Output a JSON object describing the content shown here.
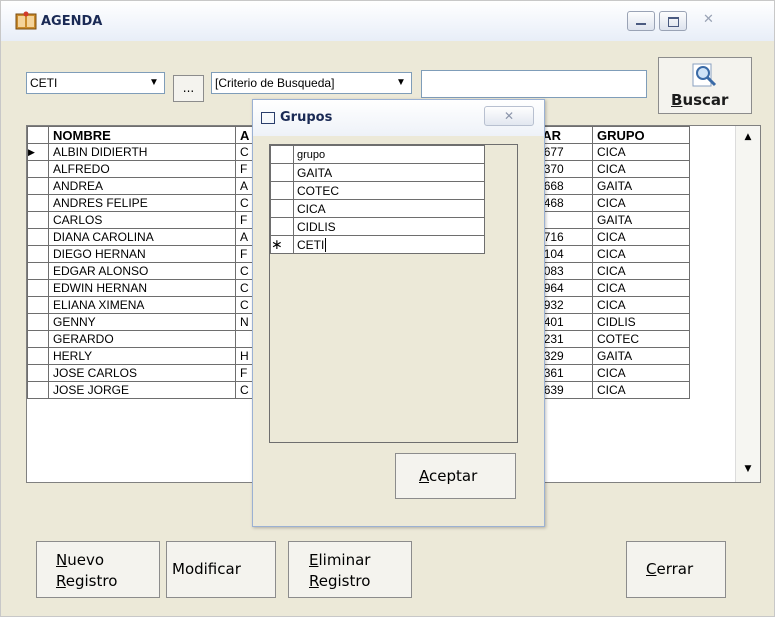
{
  "window": {
    "title": "AGENDA"
  },
  "toolbar": {
    "group_combo_value": "CETI",
    "ellipsis_label": "...",
    "criteria_combo_value": "[Criterio de Busqueda]",
    "search_text": "",
    "search_button_label_u": "B",
    "search_button_label_rest": "uscar"
  },
  "grid": {
    "headers": [
      "NOMBRE",
      "A",
      "LULAR",
      "GRUPO"
    ],
    "rows": [
      {
        "nombre": "ALBIN DIDIERTH",
        "a": "C",
        "celular": "2316677",
        "grupo": "CICA"
      },
      {
        "nombre": "ALFREDO",
        "a": "F",
        "celular": "5479370",
        "grupo": "CICA"
      },
      {
        "nombre": "ANDREA",
        "a": "A",
        "celular": "2188668",
        "grupo": "GAITA"
      },
      {
        "nombre": "ANDRES FELIPE",
        "a": "C",
        "celular": "3734468",
        "grupo": "CICA"
      },
      {
        "nombre": "CARLOS",
        "a": "F",
        "celular": "",
        "grupo": "GAITA"
      },
      {
        "nombre": "DIANA CAROLINA",
        "a": "A",
        "celular": "6550716",
        "grupo": "CICA"
      },
      {
        "nombre": "DIEGO HERNAN",
        "a": "F",
        "celular": "2539104",
        "grupo": "CICA"
      },
      {
        "nombre": "EDGAR ALONSO",
        "a": "C",
        "celular": "2857083",
        "grupo": "CICA"
      },
      {
        "nombre": "EDWIN HERNAN",
        "a": "C",
        "celular": "3061964",
        "grupo": "CICA"
      },
      {
        "nombre": "ELIANA XIMENA",
        "a": "C",
        "celular": "2902932",
        "grupo": "CICA"
      },
      {
        "nombre": "GENNY",
        "a": "N",
        "celular": "8414401",
        "grupo": "CIDLIS"
      },
      {
        "nombre": "GERARDO",
        "a": "",
        "celular": "3861231",
        "grupo": "COTEC"
      },
      {
        "nombre": "HERLY",
        "a": "H",
        "celular": "5564329",
        "grupo": "GAITA"
      },
      {
        "nombre": "JOSE CARLOS",
        "a": "F",
        "celular": "8531361",
        "grupo": "CICA"
      },
      {
        "nombre": "JOSE JORGE",
        "a": "C",
        "celular": "4750639",
        "grupo": "CICA"
      }
    ]
  },
  "dialog": {
    "title": "Grupos",
    "close_symbol": "✕",
    "column_header": "grupo",
    "rows": [
      "GAITA",
      "COTEC",
      "CICA",
      "CIDLIS"
    ],
    "new_row_marker": "∗",
    "new_row_value": "CETI",
    "accept_label_u": "A",
    "accept_label_rest": "ceptar"
  },
  "buttons": {
    "nuevo_u": "N",
    "nuevo_line1": "uevo",
    "nuevo_u2": "R",
    "nuevo_line2": "egistro",
    "modificar": "Modificar",
    "eliminar_u": "E",
    "eliminar_line1": "liminar",
    "eliminar_u2": "R",
    "eliminar_line2": "egistro",
    "cerrar_u": "C",
    "cerrar_rest": "errar"
  }
}
